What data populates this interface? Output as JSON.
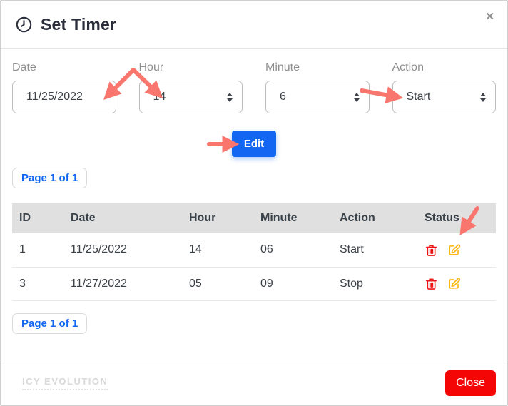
{
  "modal": {
    "title": "Set Timer",
    "close_icon": "✕"
  },
  "form": {
    "fields": [
      {
        "label": "Date",
        "value": "11/25/2022"
      },
      {
        "label": "Hour",
        "value": "14"
      },
      {
        "label": "Minute",
        "value": "6"
      },
      {
        "label": "Action",
        "value": "Start"
      }
    ],
    "edit_button_label": "Edit"
  },
  "pagination": {
    "top_label": "Page 1 of 1",
    "bottom_label": "Page 1 of 1"
  },
  "table": {
    "headers": [
      "ID",
      "Date",
      "Hour",
      "Minute",
      "Action",
      "Status"
    ],
    "rows": [
      {
        "id": "1",
        "date": "11/25/2022",
        "hour": "14",
        "minute": "06",
        "action": "Start"
      },
      {
        "id": "3",
        "date": "11/27/2022",
        "hour": "05",
        "minute": "09",
        "action": "Stop"
      }
    ]
  },
  "footer": {
    "watermark": "ICY EVOLUTION",
    "close_button_label": "Close"
  },
  "icons": {
    "header": "clock-icon",
    "row_delete": "trash-icon",
    "row_edit": "edit-pencil-icon",
    "select_stepper": "updown-stepper-icon"
  },
  "colors": {
    "primary_blue": "#1266f1",
    "danger_red": "#ee1414",
    "warning_yellow": "#fdb913",
    "close_red": "#f40606",
    "arrow_salmon": "#f8766d",
    "table_header_bg": "#e0e0e0"
  }
}
